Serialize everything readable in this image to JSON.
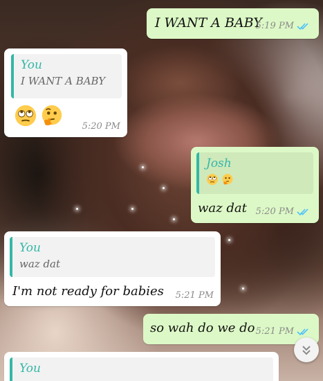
{
  "messages": [
    {
      "text": "I WANT A BABY",
      "time": "5:19 PM"
    },
    {
      "quote_author": "You",
      "quote_text": "I WANT A BABY",
      "emojis": [
        "face-with-rolling-eyes",
        "thinking-face"
      ],
      "time": "5:20 PM"
    },
    {
      "quote_author": "Josh",
      "quote_emojis": [
        "face-with-rolling-eyes",
        "thinking-face"
      ],
      "text": "waz dat",
      "time": "5:20 PM"
    },
    {
      "quote_author": "You",
      "quote_text": "waz dat",
      "text": "I'm not ready for babies",
      "time": "5:21 PM"
    },
    {
      "text": "so wah do we do",
      "time": "5:21 PM"
    },
    {
      "quote_author": "You"
    }
  ],
  "colors": {
    "outgoing_bubble": "#dcf8c6",
    "incoming_bubble": "#ffffff",
    "quote_accent": "#34b7a7",
    "read_ticks": "#4fc3f7"
  }
}
